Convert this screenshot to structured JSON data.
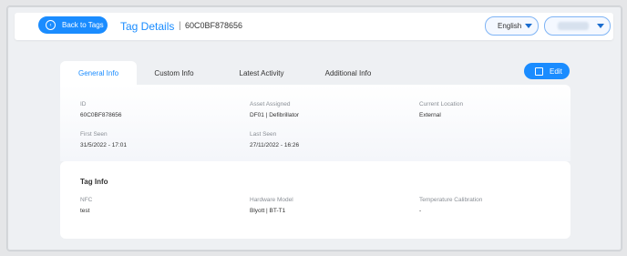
{
  "header": {
    "back_label": "Back to Tags",
    "title": "Tag Details",
    "separator": "|",
    "tag_id": "60C0BF878656",
    "language": "English"
  },
  "tabs": [
    {
      "label": "General Info",
      "active": true
    },
    {
      "label": "Custom Info",
      "active": false
    },
    {
      "label": "Latest Activity",
      "active": false
    },
    {
      "label": "Additional Info",
      "active": false
    }
  ],
  "edit_label": "Edit",
  "general": {
    "id_label": "ID",
    "id_value": "60C0BF878656",
    "asset_label": "Asset Assigned",
    "asset_value": "DF01 | Defibrillator",
    "location_label": "Current Location",
    "location_value": "External",
    "first_seen_label": "First Seen",
    "first_seen_value": "31/5/2022 - 17:01",
    "last_seen_label": "Last Seen",
    "last_seen_value": "27/11/2022 - 16:26"
  },
  "tag_info": {
    "title": "Tag Info",
    "nfc_label": "NFC",
    "nfc_value": "test",
    "hardware_label": "Hardware Model",
    "hardware_value": "Blyott | BT-T1",
    "temp_label": "Temperature Calibration",
    "temp_value": "-"
  },
  "colors": {
    "accent": "#1a8cff",
    "background": "#eef0f3"
  }
}
